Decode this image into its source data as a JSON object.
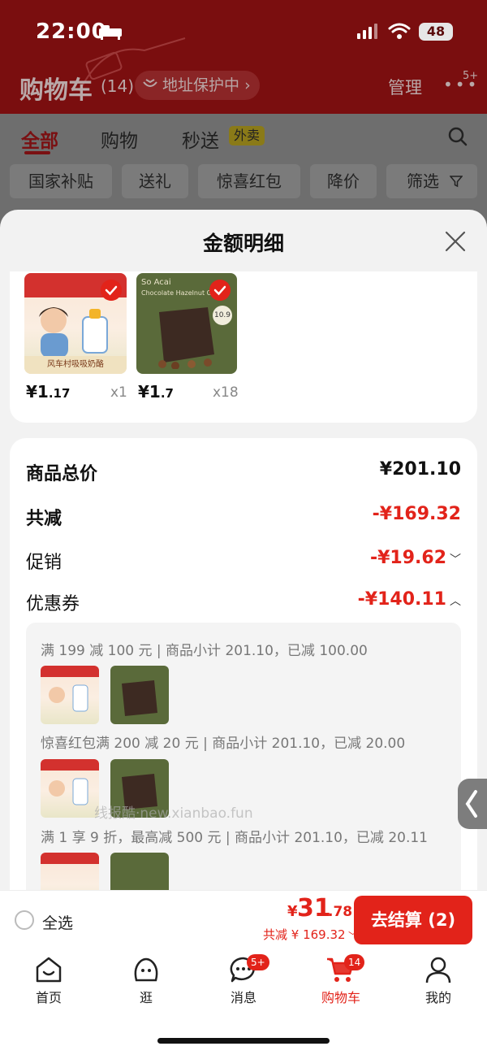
{
  "status_bar": {
    "time": "22:00",
    "battery": "48"
  },
  "header": {
    "title": "购物车",
    "count": "(14)",
    "address_pill": "地址保护中",
    "manage": "管理",
    "more_badge": "5+"
  },
  "tabs": [
    {
      "label": "全部"
    },
    {
      "label": "购物"
    },
    {
      "label": "秒送"
    }
  ],
  "takeout_badge": "外卖",
  "filters": [
    {
      "label": "国家补贴"
    },
    {
      "label": "送礼"
    },
    {
      "label": "惊喜红包"
    },
    {
      "label": "降价"
    },
    {
      "label": "筛选"
    }
  ],
  "sheet": {
    "title": "金额明细",
    "items": [
      {
        "price_int": "¥1",
        "price_dec": ".17",
        "qty": "x1",
        "thumb_caption": "风车村吸吸奶酪",
        "image": "cheese-pouch-kid",
        "color": "#f8e6d6"
      },
      {
        "price_int": "¥1",
        "price_dec": ".7",
        "qty": "x18",
        "thumb_caption": "Chocolate Hazelnut Granola",
        "image": "granola-bag",
        "color": "#5a6a3a"
      }
    ],
    "summary": {
      "goods_total_label": "商品总价",
      "goods_total": "¥201.10",
      "total_discount_label": "共减",
      "total_discount": "-¥169.32",
      "promo_label": "促销",
      "promo": "-¥19.62",
      "coupon_label": "优惠券",
      "coupon": "-¥140.11"
    },
    "coupons": [
      {
        "text": "满 199 减 100 元 | 商品小计 201.10，已减 100.00"
      },
      {
        "text": "惊喜红包满 200 减 20 元 | 商品小计 201.10，已减 20.00"
      },
      {
        "text": "满 1 享 9 折，最高减 500 元 | 商品小计 201.10，已减 20.11"
      }
    ]
  },
  "watermark": "线报酷·new.xianbao.fun",
  "checkout": {
    "select_all": "全选",
    "total_yen": "¥",
    "total_int": "31",
    "total_dec": ".78",
    "saved": "共减 ¥ 169.32",
    "pay_button": "去结算 (2)"
  },
  "nav": [
    {
      "label": "首页",
      "icon": "home-icon"
    },
    {
      "label": "逛",
      "icon": "explore-icon"
    },
    {
      "label": "消息",
      "icon": "message-icon",
      "badge": "5+"
    },
    {
      "label": "购物车",
      "icon": "cart-icon",
      "badge": "14"
    },
    {
      "label": "我的",
      "icon": "profile-icon"
    }
  ],
  "colors": {
    "accent": "#e2231a",
    "header_bg": "#7a0e0f",
    "takeout": "#8a7a18"
  }
}
